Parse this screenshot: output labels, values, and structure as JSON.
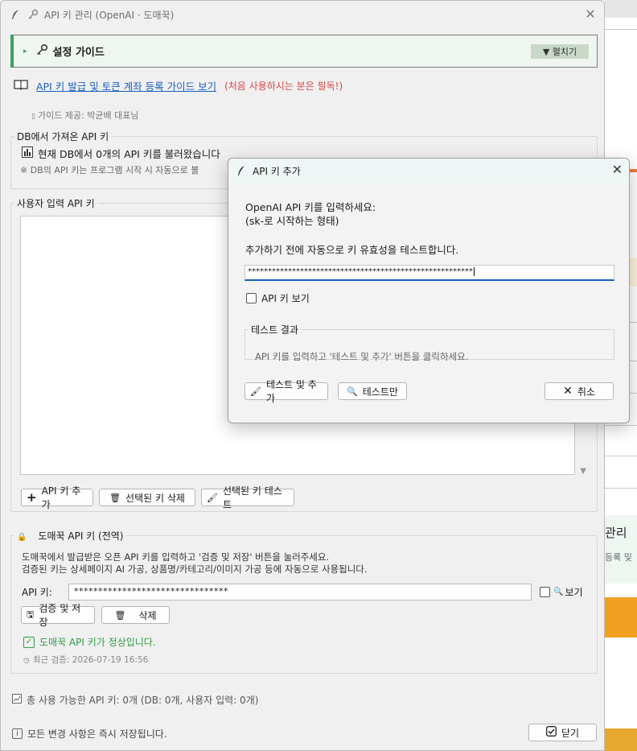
{
  "window": {
    "title": "API 키 관리 (OpenAI · 도매꾹)"
  },
  "guide": {
    "title": "설정 가이드",
    "expand_label": "▼ 펼치기",
    "link_text": "API 키 발급 및 토큰 계좌 등록 가이드 보기",
    "warning": "(처음 사용하시는 분은 필독!)",
    "provider": "가이드 제공: 박균배 대표님"
  },
  "db_group": {
    "legend": "DB에서 가져온 API 키",
    "status": "현재 DB에서 0개의 API 키를 불러왔습니다",
    "note": "※ DB의 API 키는 프로그램 시작 시 자동으로 불"
  },
  "user_group": {
    "legend": "사용자 입력 API 키",
    "add_button": "API 키 추가",
    "delete_button": "선택된 키 삭제",
    "test_button": "선택된 키 테스트"
  },
  "dmk_group": {
    "legend": "도매꾹 API 키 (전역)",
    "desc1": "도매꾹에서 발급받은 오픈 API 키를 입력하고 '검증 및 저장' 버튼을 눌러주세요.",
    "desc2": "검증된 키는 상세페이지 AI 가공, 상품명/카테고리/이미지 가공 등에 자동으로 사용됩니다.",
    "api_label": "API 키:",
    "api_value": "********************************",
    "show_label": "보기",
    "verify_button": "검증 및 저장",
    "delete_button": "삭제",
    "ok_text": "도매꾹 API 키가 정상입니다.",
    "last_check": "최근 검증: 2026-07-19 16:56"
  },
  "footer": {
    "total": "총 사용 가능한 API 키: 0개 (DB: 0개, 사용자 입력: 0개)",
    "saved": "모든 변경 사항은 즉시 저장됩니다.",
    "close_button": "닫기"
  },
  "dialog": {
    "title": "API 키 추가",
    "prompt1": "OpenAI API 키를 입력하세요:",
    "prompt2": "(sk-로 시작하는 형태)",
    "sub": "추가하기 전에 자동으로 키 유효성을 테스트합니다.",
    "input_value": "********************************************************",
    "show_label": "API 키 보기",
    "result_legend": "테스트 결과",
    "result_msg": "API 키를 입력하고 '테스트 및 추가' 버튼을 클릭하세요.",
    "test_add_button": "테스트 및 추가",
    "test_only_button": "테스트만",
    "cancel_button": "취소"
  },
  "background_app": {
    "title": "관리",
    "sub": "등록 및"
  },
  "colors": {
    "accent_green": "#3aa35a",
    "link_blue": "#1a5fbf",
    "warn_red": "#d64545",
    "bg_orange": "#f0a020"
  }
}
